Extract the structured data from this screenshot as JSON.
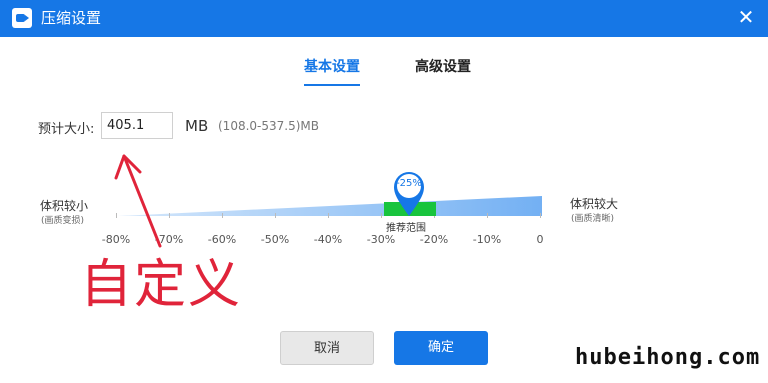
{
  "window": {
    "title": "压缩设置",
    "close_glyph": "✕"
  },
  "tabs": [
    {
      "label": "基本设置",
      "active": true
    },
    {
      "label": "高级设置",
      "active": false
    }
  ],
  "size": {
    "label": "预计大小:",
    "value": "405.1",
    "unit": "MB",
    "range_note": "(108.0-537.5)MB"
  },
  "slider": {
    "left_label": "体积较小",
    "left_sub": "(画质变损)",
    "right_label": "体积较大",
    "right_sub": "(画质清晰)",
    "axis_labels": [
      "-80%",
      "-70%",
      "-60%",
      "-50%",
      "-40%",
      "-30%",
      "-20%",
      "-10%",
      "0"
    ],
    "recommended_label": "推荐范围",
    "current_label": "-25%",
    "current_value": -25
  },
  "annotation": {
    "text": "自定义",
    "color": "#e0243a"
  },
  "buttons": {
    "cancel": "取消",
    "ok": "确定"
  },
  "watermark": "hubeihong.com",
  "colors": {
    "accent": "#1677e6",
    "recommended": "#18c43d",
    "annotation": "#e0243a"
  }
}
